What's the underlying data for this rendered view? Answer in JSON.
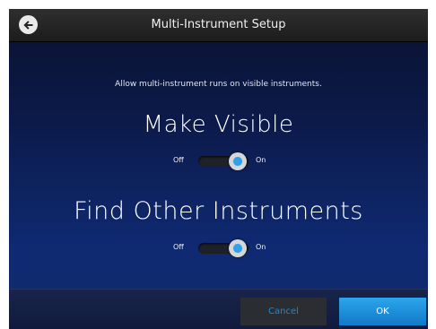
{
  "header": {
    "title": "Multi-Instrument Setup",
    "back_icon": "back-arrow-icon"
  },
  "main": {
    "description": "Allow multi-instrument runs on visible instruments.",
    "sections": [
      {
        "heading": "Make Visible",
        "toggle": {
          "off_label": "Off",
          "on_label": "On",
          "state": "on"
        }
      },
      {
        "heading": "Find Other Instruments",
        "toggle": {
          "off_label": "Off",
          "on_label": "On",
          "state": "on"
        }
      }
    ]
  },
  "footer": {
    "cancel_label": "Cancel",
    "ok_label": "OK"
  },
  "colors": {
    "accent": "#2a9ee8",
    "toggle_on": "#2ea0ee",
    "cancel_text": "#1e88d6"
  }
}
